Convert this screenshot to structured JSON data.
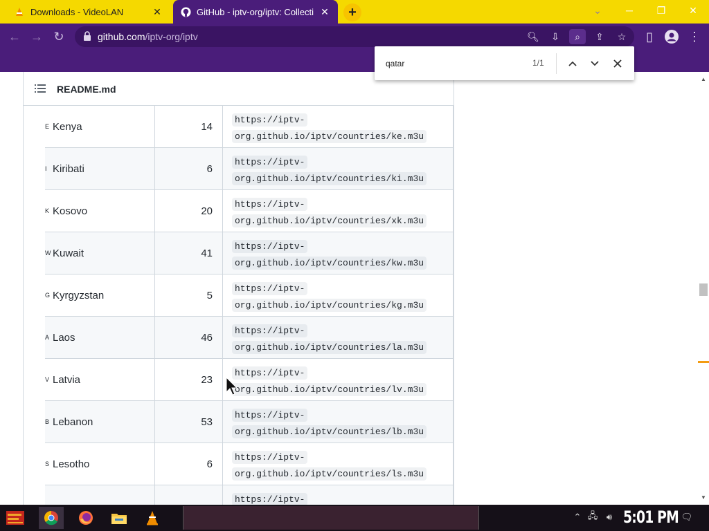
{
  "tabs": [
    {
      "title": "Downloads - VideoLAN",
      "icon": "vlc-cone-icon"
    },
    {
      "title": "GitHub - iptv-org/iptv: Collecti",
      "icon": "github-icon"
    }
  ],
  "address_bar": {
    "host": "github.com",
    "path": "/iptv-org/iptv"
  },
  "find_bar": {
    "query": "qatar",
    "count": "1/1"
  },
  "readme": {
    "title": "README.md"
  },
  "countries": [
    {
      "code": "E",
      "name": "Kenya",
      "count": "14",
      "url_line1": "https://iptv-",
      "url_line2": "org.github.io/iptv/countries/ke.m3u"
    },
    {
      "code": "I",
      "name": "Kiribati",
      "count": "6",
      "url_line1": "https://iptv-",
      "url_line2": "org.github.io/iptv/countries/ki.m3u"
    },
    {
      "code": "K",
      "name": "Kosovo",
      "count": "20",
      "url_line1": "https://iptv-",
      "url_line2": "org.github.io/iptv/countries/xk.m3u"
    },
    {
      "code": "W",
      "name": "Kuwait",
      "count": "41",
      "url_line1": "https://iptv-",
      "url_line2": "org.github.io/iptv/countries/kw.m3u"
    },
    {
      "code": "G",
      "name": "Kyrgyzstan",
      "count": "5",
      "url_line1": "https://iptv-",
      "url_line2": "org.github.io/iptv/countries/kg.m3u"
    },
    {
      "code": "A",
      "name": "Laos",
      "count": "46",
      "url_line1": "https://iptv-",
      "url_line2": "org.github.io/iptv/countries/la.m3u"
    },
    {
      "code": "V",
      "name": "Latvia",
      "count": "23",
      "url_line1": "https://iptv-",
      "url_line2": "org.github.io/iptv/countries/lv.m3u"
    },
    {
      "code": "B",
      "name": "Lebanon",
      "count": "53",
      "url_line1": "https://iptv-",
      "url_line2": "org.github.io/iptv/countries/lb.m3u"
    },
    {
      "code": "S",
      "name": "Lesotho",
      "count": "6",
      "url_line1": "https://iptv-",
      "url_line2": "org.github.io/iptv/countries/ls.m3u"
    },
    {
      "code": "",
      "name": "",
      "count": "",
      "url_line1": "https://iptv-",
      "url_line2": ""
    }
  ],
  "taskbar": {
    "apps": [
      "chrome-icon",
      "firefox-icon",
      "file-explorer-icon",
      "vlc-icon"
    ],
    "clock": "5:01 PM"
  },
  "colors": {
    "tab_strip": "#f5d900",
    "browser_frame": "#4a1d7a",
    "table_border": "#d0d7de",
    "row_alt": "#f6f8fa"
  }
}
